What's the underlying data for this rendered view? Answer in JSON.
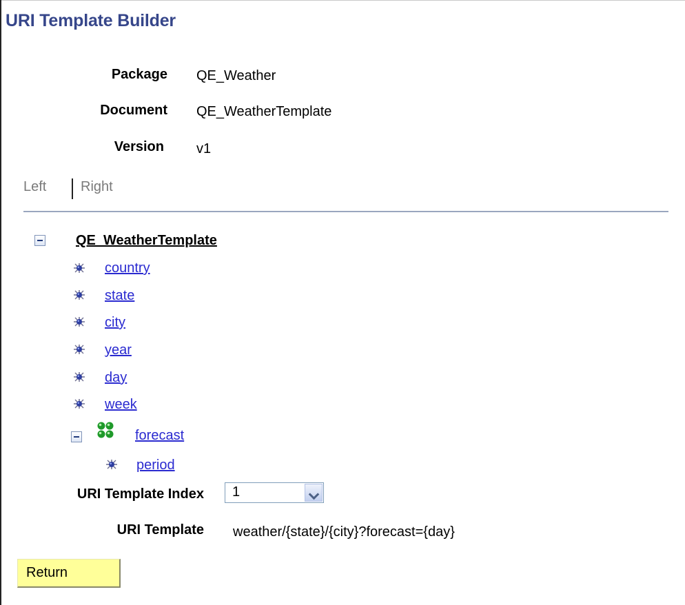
{
  "page": {
    "title": "URI Template Builder"
  },
  "fields": {
    "package_label": "Package",
    "package_value": "QE_Weather",
    "document_label": "Document",
    "document_value": "QE_WeatherTemplate",
    "version_label": "Version",
    "version_value": "v1"
  },
  "view_toggle": {
    "left": "Left",
    "right": "Right"
  },
  "tree": {
    "root": "QE_WeatherTemplate",
    "nodes": [
      "country",
      "state",
      "city",
      "year",
      "day",
      "week"
    ],
    "group": "forecast",
    "group_children": [
      "period"
    ]
  },
  "template_index": {
    "label": "URI Template Index",
    "selected": "1"
  },
  "template": {
    "label": "URI Template",
    "value": "weather/{state}/{city}?forecast={day}"
  },
  "actions": {
    "return_label": "Return"
  },
  "colors": {
    "title": "#36468a",
    "link": "#2a2ad0",
    "button_bg": "#ffff99"
  }
}
